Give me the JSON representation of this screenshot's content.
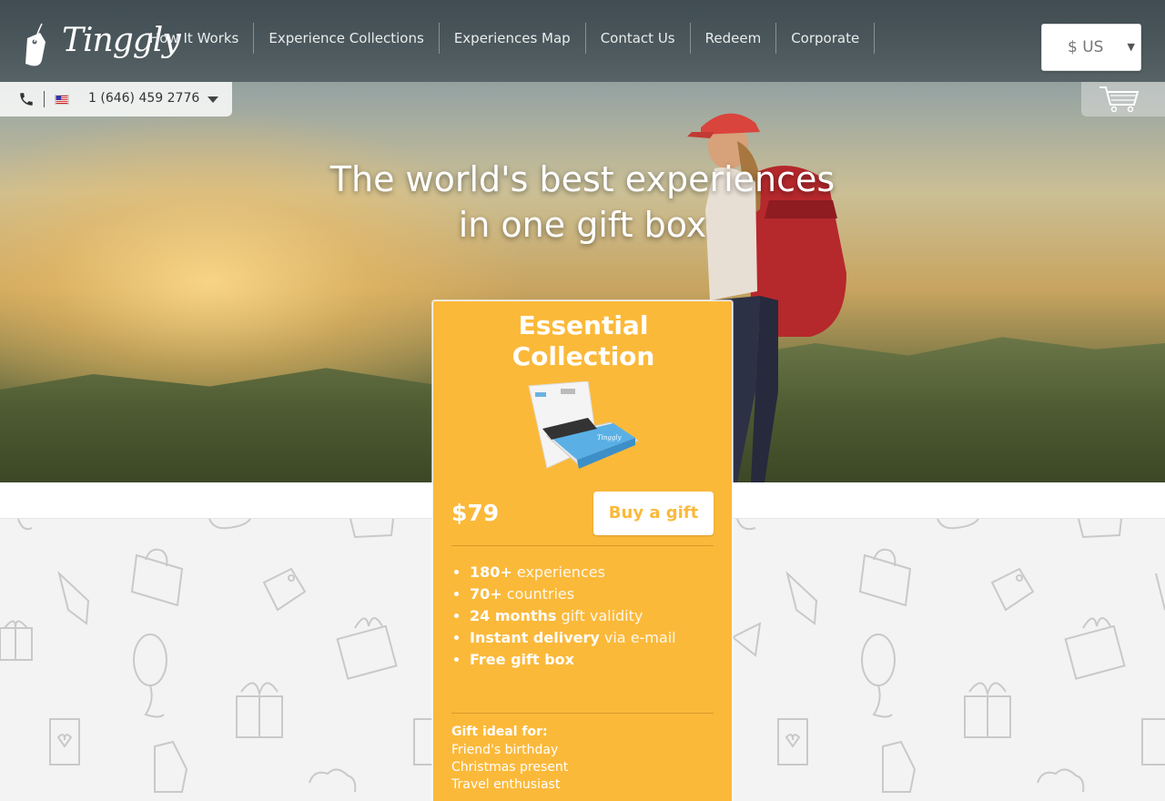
{
  "brand": {
    "logo_text": "Tinggly"
  },
  "nav": {
    "items": [
      {
        "label": "How It Works"
      },
      {
        "label": "Experience Collections"
      },
      {
        "label": "Experiences Map"
      },
      {
        "label": "Contact Us"
      },
      {
        "label": "Redeem"
      },
      {
        "label": "Corporate"
      }
    ]
  },
  "currency": {
    "value": "$ US"
  },
  "contact": {
    "phone": "1 (646) 459 2776",
    "country_flag": "us-flag"
  },
  "cart": {
    "icon": "cart-icon"
  },
  "hero": {
    "headline_line1": "The world's best experiences",
    "headline_line2": "in one gift box"
  },
  "card": {
    "title_line1": "Essential",
    "title_line2": "Collection",
    "price": "$79",
    "buy_label": "Buy a gift",
    "features": [
      {
        "bold": "180+",
        "rest": " experiences"
      },
      {
        "bold": "70+",
        "rest": " countries"
      },
      {
        "bold": "24 months",
        "rest": " gift validity"
      },
      {
        "bold": "Instant delivery",
        "rest": " via e-mail"
      },
      {
        "bold": "Free gift box",
        "rest": ""
      }
    ],
    "ideal_title": "Gift ideal for:",
    "ideal_for": [
      "Friend's birthday",
      "Christmas present",
      "Travel enthusiast"
    ]
  },
  "colors": {
    "accent": "#fbb93a",
    "nav_bg": "#3c484e",
    "pattern_stroke": "#c9c9c9"
  }
}
